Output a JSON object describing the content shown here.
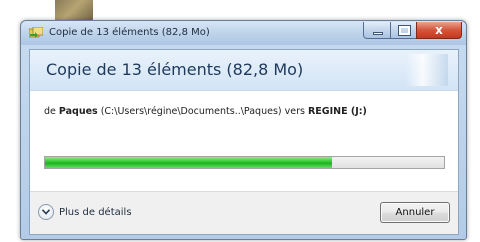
{
  "window": {
    "title": "Copie de 13 éléments (82,8 Mo)",
    "close_glyph": "x"
  },
  "dialog": {
    "heading": "Copie de 13 éléments (82,8 Mo)",
    "source_prefix": "de ",
    "source_name": "Paques",
    "source_path": " (C:\\Users\\régine\\Documents..\\Paques) vers ",
    "destination_name": "REGINE (J:)",
    "progress_fraction": 0.72
  },
  "footer": {
    "details_label": "Plus de détails",
    "cancel_label": "Annuler"
  },
  "colors": {
    "progress_green": "#2ec72e",
    "heading_blue": "#1e395b"
  }
}
